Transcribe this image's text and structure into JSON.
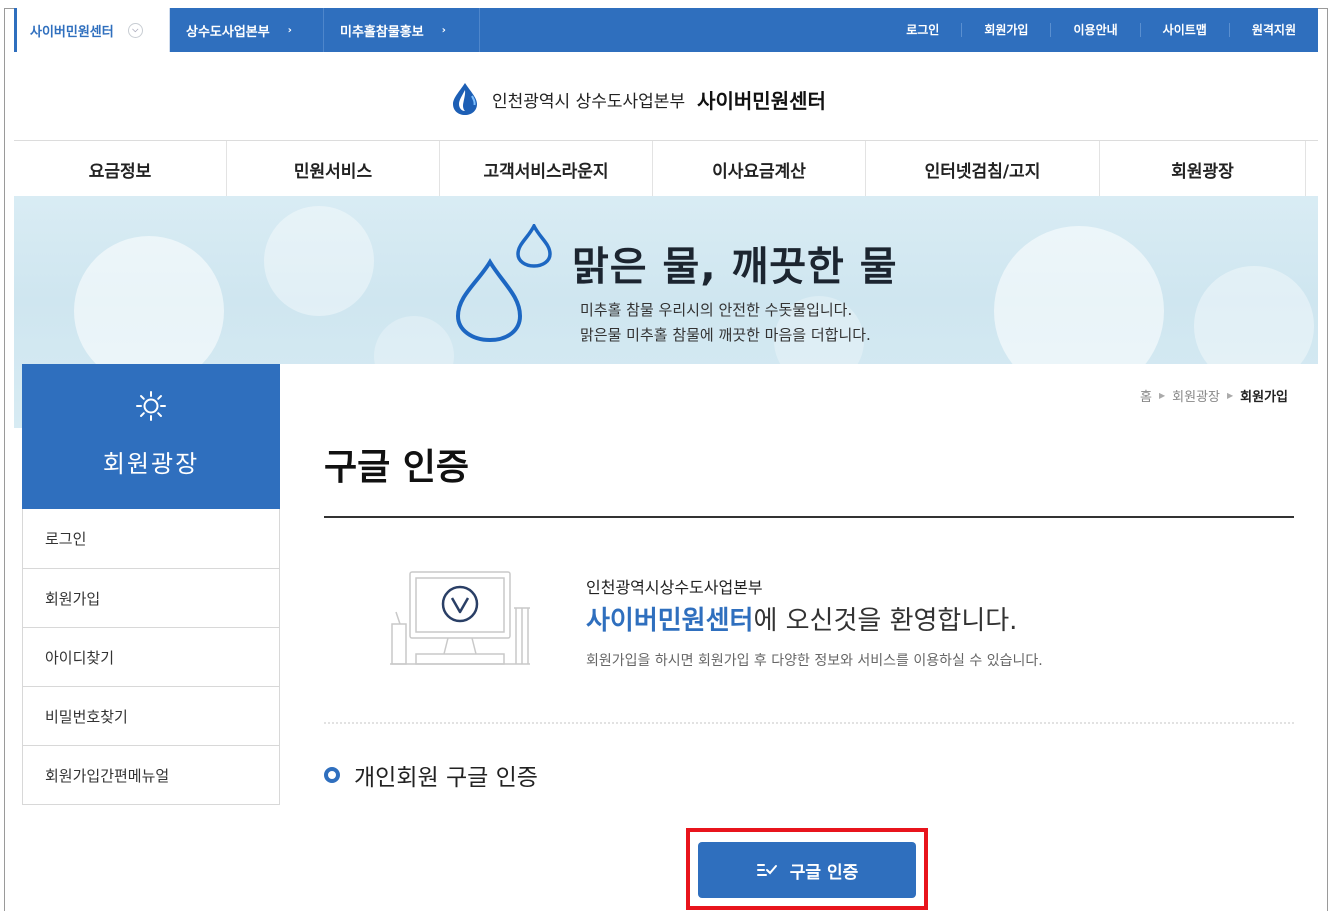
{
  "topbar": {
    "site_tabs": [
      "사이버민원센터",
      "상수도사업본부",
      "미추홀참물홍보"
    ],
    "util_links": [
      "로그인",
      "회원가입",
      "이용안내",
      "사이트맵",
      "원격지원"
    ]
  },
  "header": {
    "org": "인천광역시 상수도사업본부",
    "service": "사이버민원센터"
  },
  "gnb": [
    "요금정보",
    "민원서비스",
    "고객서비스라운지",
    "이사요금계산",
    "인터넷검침/고지",
    "회원광장"
  ],
  "banner": {
    "title": "맑은 물, 깨끗한 물",
    "line1": "미추홀 참물 우리시의 안전한 수돗물입니다.",
    "line2": "맑은물 미추홀 참물에 깨끗한 마음을 더합니다."
  },
  "lnb": {
    "title": "회원광장",
    "items": [
      "로그인",
      "회원가입",
      "아이디찾기",
      "비밀번호찾기",
      "회원가입간편메뉴얼"
    ]
  },
  "breadcrumb": [
    "홈",
    "회원광장",
    "회원가입"
  ],
  "main": {
    "title": "구글 인증",
    "welcome_org": "인천광역시상수도사업본부",
    "welcome_em": "사이버민원센터",
    "welcome_rest": "에 오신것을 환영합니다.",
    "welcome_desc": "회원가입을 하시면 회원가입 후 다양한 정보와 서비스를 이용하실 수 있습니다.",
    "section_title": "개인회원 구글 인증",
    "button_label": "구글 인증"
  },
  "colors": {
    "primary": "#2f6fbe",
    "highlight": "#e8141c"
  }
}
